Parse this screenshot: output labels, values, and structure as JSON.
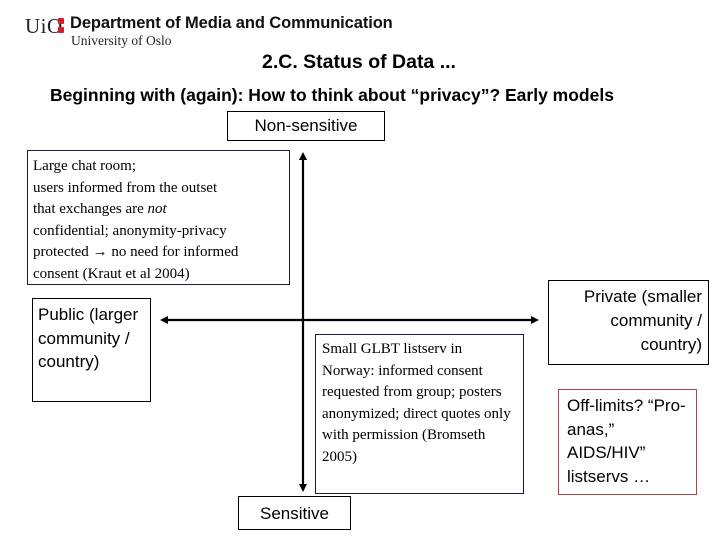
{
  "header": {
    "logo_text": "UiO",
    "department": "Department of Media and Communication",
    "university": "University of Oslo",
    "brand_color": "#d21e2b"
  },
  "slide": {
    "title": "2.C. Status of Data ...",
    "subtitle": "Beginning with (again): How to think about “privacy”?  Early models"
  },
  "axes": {
    "top_label": "Non-sensitive",
    "bottom_label": "Sensitive",
    "left_label": "Public (larger community / country)",
    "right_label": "Private (smaller community / country)"
  },
  "boxes": {
    "chatroom": {
      "line1": "Large chat room;",
      "line2": "users informed from the outset",
      "line3_pre": "that exchanges are ",
      "line3_italic": "not",
      "line4": "confidential; anonymity-privacy",
      "line5_pre": "protected ",
      "line5_arrow": "→",
      "line5_post": " no need for informed",
      "line6": "consent (Kraut et al 2004)"
    },
    "glbt": {
      "text": "Small GLBT listserv in Norway: informed consent requested from group; posters anonymized; direct quotes only with permission  (Bromseth 2005)"
    },
    "offlimits": {
      "text": "Off-limits? “Pro-anas,” AIDS/HIV” listservs …",
      "border_color": "#b04050"
    }
  }
}
